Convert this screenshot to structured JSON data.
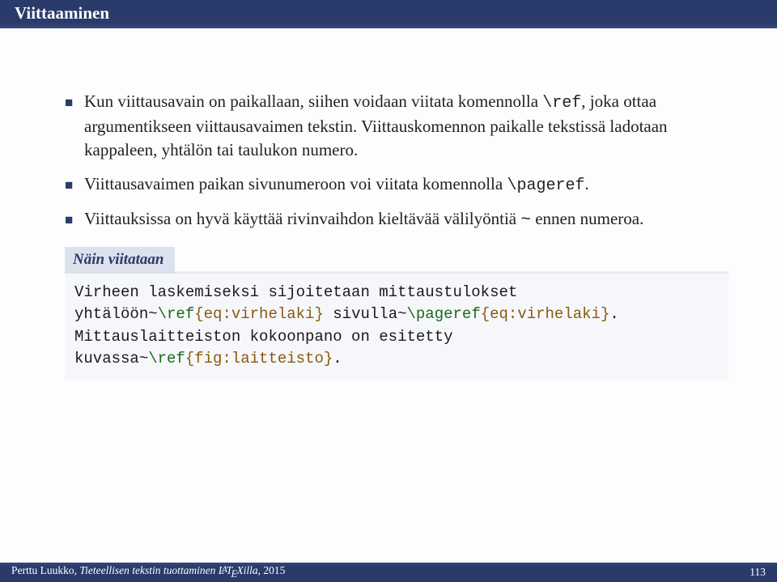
{
  "header": {
    "title": "Viittaaminen"
  },
  "bullets": [
    {
      "pre": "Kun viittausavain on paikallaan, siihen voidaan viitata komennolla ",
      "code": "\\ref",
      "post": ", joka ottaa argumentikseen viittausavaimen tekstin. Viittauskomennon paikalle tekstissä ladotaan kappaleen, yhtälön tai taulukon numero."
    },
    {
      "pre": "Viittausavaimen paikan sivunumeroon voi viitata komennolla ",
      "code": "\\pageref",
      "post": "."
    },
    {
      "pre": "Viittauksissa on hyvä käyttää rivinvaihdon kieltävää välilyöntiä ",
      "tilde": "~",
      "post": " ennen numeroa."
    }
  ],
  "box": {
    "title": "Näin viitataan",
    "line1a": "Virheen laskemiseksi sijoitetaan mittaustulokset",
    "line2a": "yhtälöön~",
    "line2cmd": "\\ref",
    "line2brace": "{eq:virhelaki}",
    "line2b": " sivulla~",
    "line2cmd2": "\\pageref",
    "line2brace2": "{eq:virhelaki}",
    "line2c": ".",
    "line3a": "Mittauslaitteiston kokoonpano on esitetty",
    "line4a": "kuvassa~",
    "line4cmd": "\\ref",
    "line4brace": "{fig:laitteisto}",
    "line4b": "."
  },
  "footer": {
    "author": "Perttu Luukko, ",
    "title_italic": "Tieteellisen tekstin tuottaminen ",
    "latex_part": "LATEXilla",
    "year": ", 2015",
    "page": "113"
  }
}
